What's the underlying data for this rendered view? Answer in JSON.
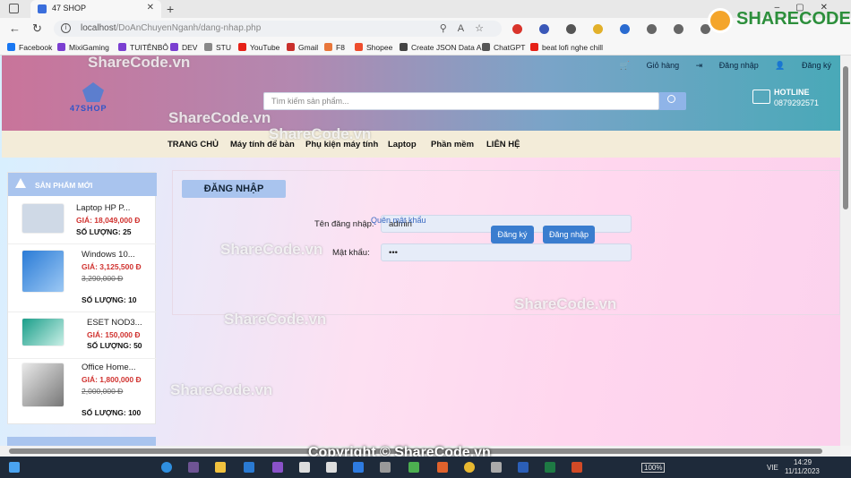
{
  "browser": {
    "tab_title": "47 SHOP",
    "url_host": "localhost",
    "url_path": "/DoAnChuyenNganh/dang-nhap.php",
    "bookmarks": [
      "Facebook",
      "MixiGaming",
      "TUITÊNBÔ",
      "DEV",
      "STU",
      "YouTube",
      "Gmail",
      "F8",
      "Shopee",
      "Create JSON Data AI",
      "ChatGPT",
      "beat lofi nghe chill"
    ]
  },
  "header": {
    "toplinks": [
      "Giỏ hàng",
      "Đăng nhập",
      "Đăng ký"
    ],
    "search_placeholder": "Tìm kiếm sản phẩm...",
    "hotline_title": "HOTLINE",
    "hotline_number": "0879292571"
  },
  "nav": [
    "TRANG CHỦ",
    "Máy tính để bàn",
    "Phụ kiện máy tính",
    "Laptop",
    "Phần mềm",
    "LIÊN HỆ"
  ],
  "sidebar": {
    "title": "SẢN PHẨM MỚI",
    "products": [
      {
        "name": "Laptop HP P...",
        "price": "GIÁ: 18,049,000 Đ",
        "old_price": "",
        "qty": "SỐ LƯỢNG: 25"
      },
      {
        "name": "Windows 10...",
        "price": "GIÁ: 3,125,500 Đ",
        "old_price": "3,290,000 Đ",
        "qty": "SỐ LƯỢNG: 10"
      },
      {
        "name": "ESET NOD3...",
        "price": "GIÁ: 150,000 Đ",
        "old_price": "",
        "qty": "SỐ LƯỢNG: 50"
      },
      {
        "name": "Office Home...",
        "price": "GIÁ: 1,800,000 Đ",
        "old_price": "2,000,000 Đ",
        "qty": "SỐ LƯỢNG: 100"
      }
    ]
  },
  "login": {
    "title": "ĐĂNG NHẬP",
    "username_label": "Tên đăng nhập:",
    "username_value": "admin",
    "password_label": "Mật khẩu:",
    "password_value": "•••",
    "forgot": "Quên mật khẩu",
    "register_button": "Đăng ký",
    "login_button": "Đăng nhập"
  },
  "watermark": {
    "text": "ShareCode.vn",
    "brand": "SHARECODE.vn",
    "footer": "Copyright © ShareCode.vn"
  },
  "taskbar": {
    "battery": "100%",
    "lang": "VIE",
    "time": "14:29",
    "date": "11/11/2023"
  }
}
